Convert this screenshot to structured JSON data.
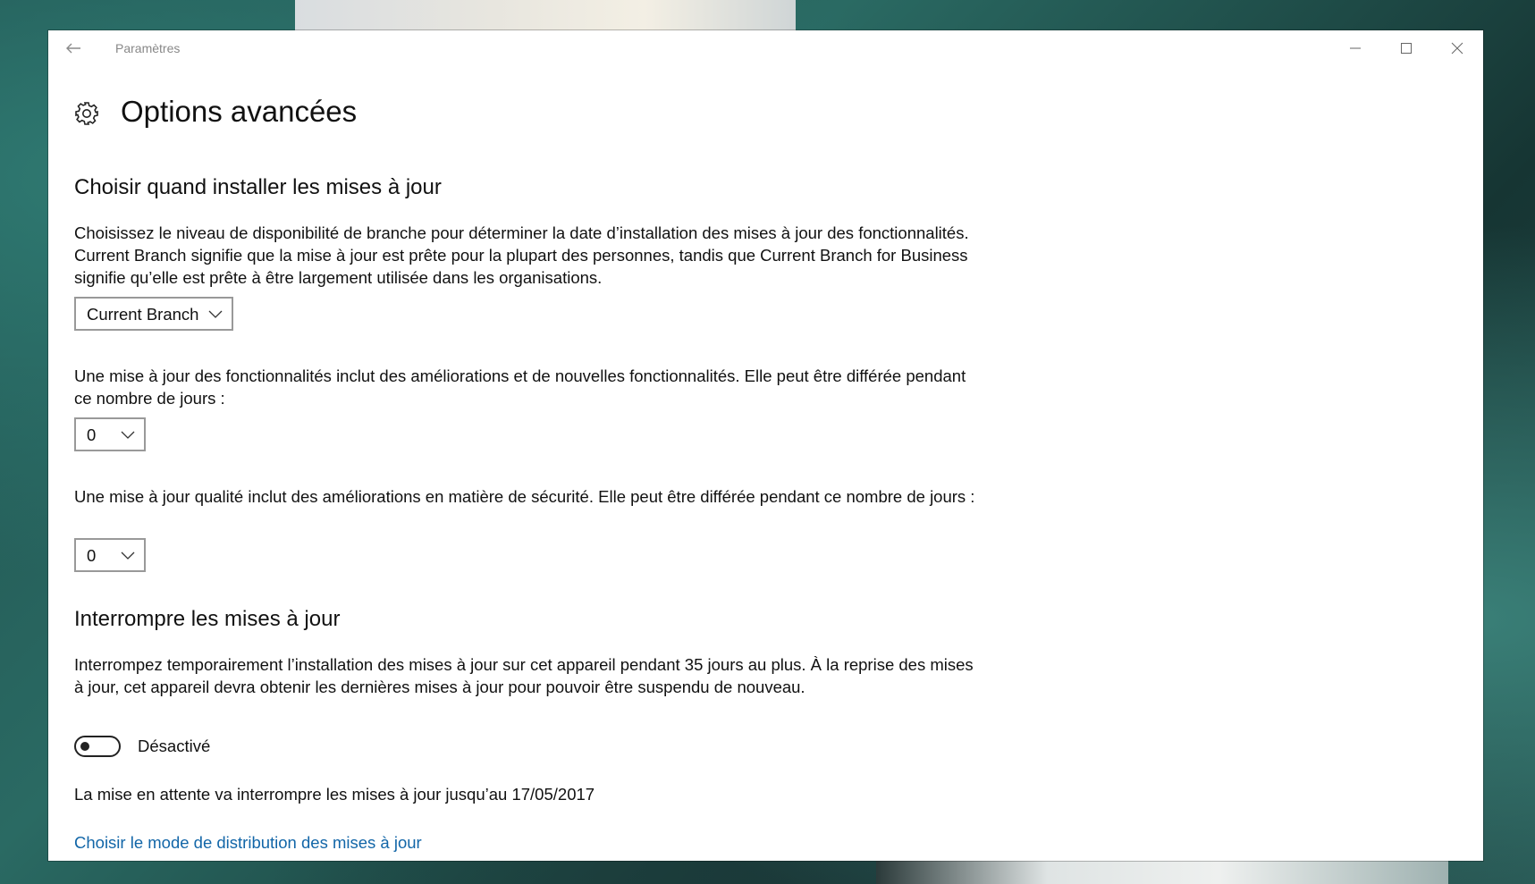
{
  "window": {
    "app_title": "Paramètres"
  },
  "header": {
    "title": "Options avancées"
  },
  "section_install": {
    "heading": "Choisir quand installer les mises à jour",
    "branch_description": "Choisissez le niveau de disponibilité de branche pour déterminer la date d’installation des mises à jour des fonctionnalités. Current Branch signifie que la mise à jour est prête pour la plupart des personnes, tandis que Current Branch for Business signifie qu’elle est prête à être largement utilisée dans les organisations.",
    "branch_select_value": "Current Branch",
    "feature_description": "Une mise à jour des fonctionnalités inclut des améliorations et de nouvelles fonctionnalités. Elle peut être différée pendant ce nombre de jours :",
    "feature_days_value": "0",
    "quality_description": "Une mise à jour qualité inclut des améliorations en matière de sécurité. Elle peut être différée pendant ce nombre de jours :",
    "quality_days_value": "0"
  },
  "section_pause": {
    "heading": "Interrompre les mises à jour",
    "description": "Interrompez temporairement l’installation des mises à jour sur cet appareil pendant 35 jours au plus. À la reprise des mises à jour, cet appareil devra obtenir les dernières mises à jour pour pouvoir être suspendu de nouveau.",
    "toggle_state": "off",
    "toggle_label": "Désactivé",
    "pause_until_text": "La mise en attente va interrompre les mises à jour jusqu’au 17/05/2017",
    "delivery_link": "Choisir le mode de distribution des mises à jour"
  },
  "colors": {
    "link": "#1266a8",
    "window_bg": "#ffffff"
  },
  "icons": [
    "back-arrow-icon",
    "minimize-icon",
    "maximize-icon",
    "close-icon",
    "gear-icon",
    "chevron-down-icon"
  ]
}
